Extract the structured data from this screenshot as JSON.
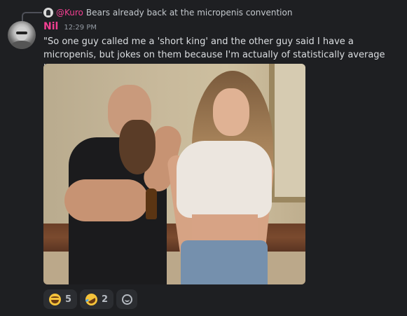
{
  "reply": {
    "author": "@Kuro",
    "text": "Bears already back at the micropenis convention",
    "avatar_icon": "user-avatar-icon"
  },
  "message": {
    "author": "Nil",
    "author_color": "#f23f91",
    "timestamp": "12:29 PM",
    "text": "\"So one guy called me a 'short king' and the other guy said I have a micropenis, but jokes on them because I'm actually of statistically average height and penis size.\"",
    "avatar_icon": "user-avatar-icon"
  },
  "attachment": {
    "type": "image",
    "icon": "photo-attachment"
  },
  "reactions": [
    {
      "emoji": "face-with-tears-of-joy",
      "count": "5"
    },
    {
      "emoji": "rolling-on-the-floor-laughing",
      "count": "2"
    }
  ],
  "add_reaction_icon": "add-reaction-icon"
}
